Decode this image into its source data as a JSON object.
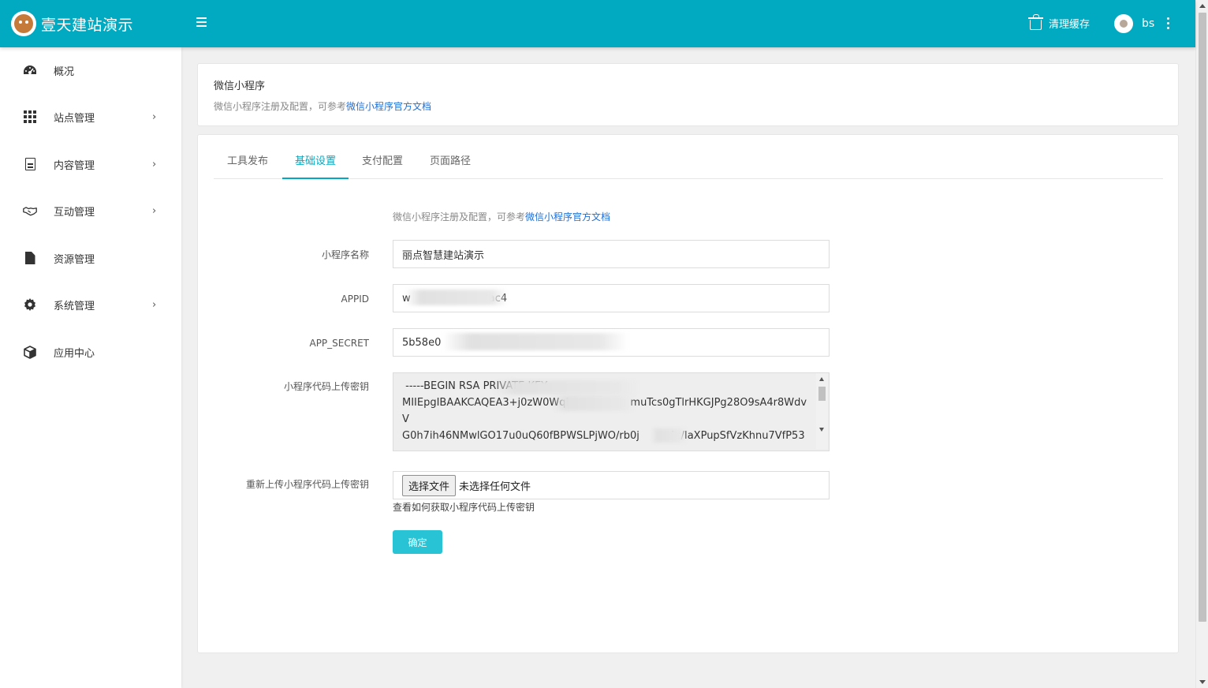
{
  "app": {
    "title": "壹天建站演示"
  },
  "header": {
    "clear_cache": "清理缓存",
    "user": "bs"
  },
  "sidebar": {
    "items": [
      {
        "label": "概况",
        "icon": "dashboard-icon",
        "has_children": false
      },
      {
        "label": "站点管理",
        "icon": "grid-icon",
        "has_children": true,
        "arrow": "›"
      },
      {
        "label": "内容管理",
        "icon": "document-icon",
        "has_children": true,
        "arrow": "›"
      },
      {
        "label": "互动管理",
        "icon": "handshake-icon",
        "has_children": true,
        "arrow": "›"
      },
      {
        "label": "资源管理",
        "icon": "file-icon",
        "has_children": false
      },
      {
        "label": "系统管理",
        "icon": "gear-icon",
        "has_children": true,
        "arrow": "›"
      },
      {
        "label": "应用中心",
        "icon": "cube-icon",
        "has_children": false
      }
    ]
  },
  "intro": {
    "title": "微信小程序",
    "desc": "微信小程序注册及配置，可参考",
    "link": "微信小程序官方文档"
  },
  "tabs": [
    {
      "label": "工具发布",
      "active": false
    },
    {
      "label": "基础设置",
      "active": true
    },
    {
      "label": "支付配置",
      "active": false
    },
    {
      "label": "页面路径",
      "active": false
    }
  ],
  "form": {
    "hint": "微信小程序注册及配置，可参考",
    "hint_link": "微信小程序官方文档",
    "name_label": "小程序名称",
    "name_value": "丽点智慧建站演示",
    "appid_label": "APPID",
    "appid_value": "w                        ac4",
    "secret_label": "APP_SECRET",
    "secret_value": "5b58e0              26db",
    "key_label": "小程序代码上传密钥",
    "key_value": " -----BEGIN RSA PRIVATE KEY-----\nMIIEpgIBAAKCAQEA3+j0zW0Wqk                  muTcs0gTlrHKGJPg28O9sA4r8WdvV\nG0h7ih46NMwlGO17u0uQ60fBPWSLPjWO/rb0j         4c/IaXPupSfVzKhnu7VfP53",
    "reupload_label": "重新上传小程序代码上传密钥",
    "choose_file": "选择文件",
    "no_file": "未选择任何文件",
    "help": "查看如何获取小程序代码上传密钥",
    "submit": "确定"
  },
  "colors": {
    "primary": "#01aac1",
    "button": "#28c4d5",
    "link": "#1e6fd9"
  }
}
